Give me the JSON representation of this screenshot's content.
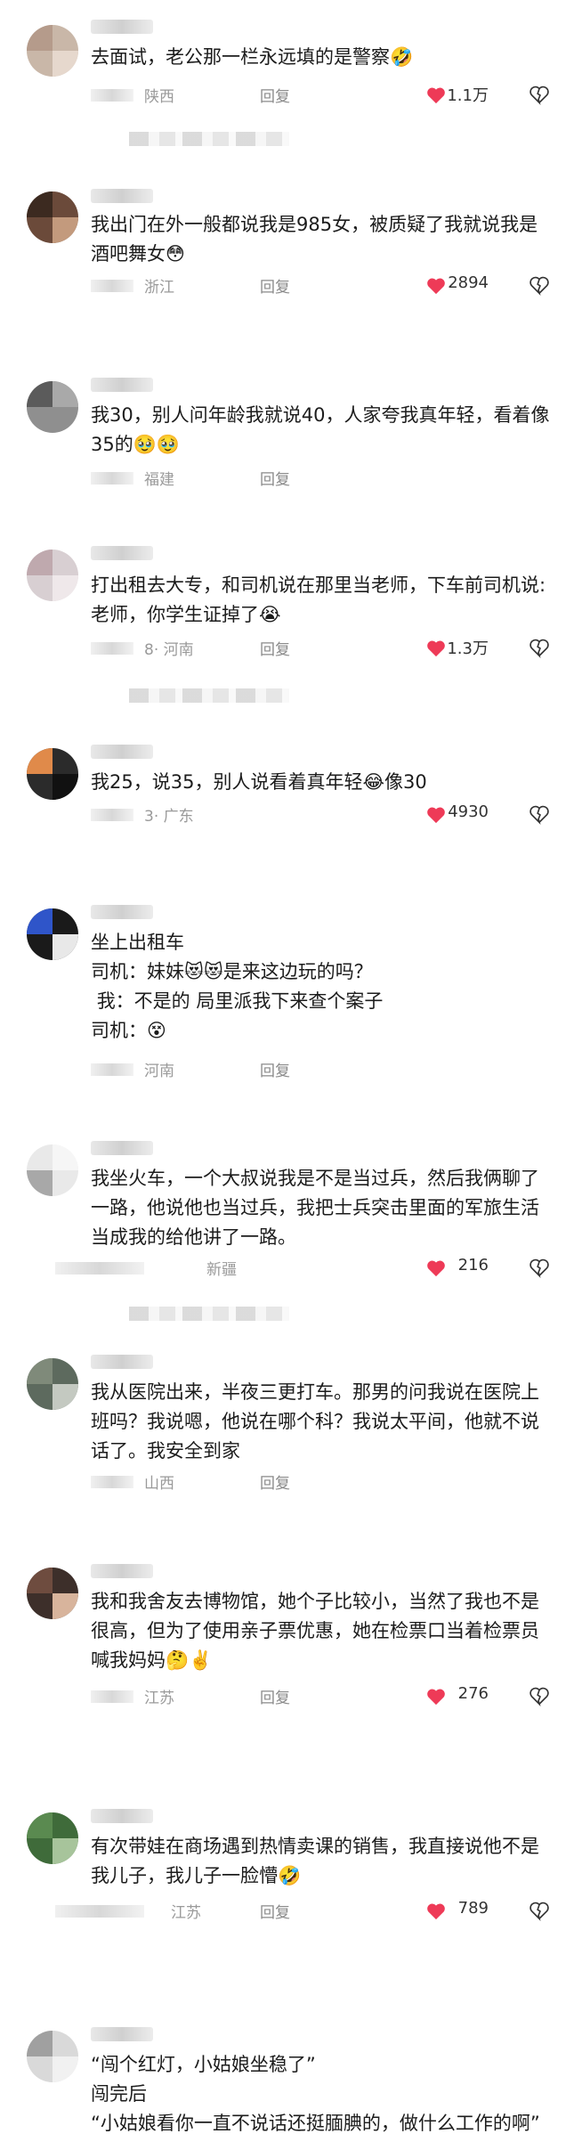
{
  "comments": [
    {
      "body": "去面试，老公那一栏永远填的是警察🤣",
      "location": "陕西",
      "reply": "回复",
      "likes": "1.1万"
    },
    {
      "body": "我出门在外一般都说我是985女，被质疑了我就说我是酒吧舞女😳",
      "location": "浙江",
      "reply": "回复",
      "likes": "2894"
    },
    {
      "body": "我30，别人问年龄我就说40，人家夸我真年轻，看着像35的🥹🥹",
      "location": "福建",
      "reply": "回复",
      "likes": ""
    },
    {
      "body": "打出租去大专，和司机说在那里当老师，下车前司机说:老师，你学生证掉了😭",
      "location": "8· 河南",
      "reply": "回复",
      "likes": "1.3万"
    },
    {
      "body": "我25，说35，别人说看着真年轻😂像30",
      "location": "3· 广东",
      "reply": "回复",
      "likes": "4930"
    },
    {
      "body": "坐上出租车\n司机：妹妹😻😻是来这边玩的吗？\n 我：不是的 局里派我下来查个案子\n司机：😵",
      "location": "河南",
      "reply": "回复",
      "likes": ""
    },
    {
      "body": "我坐火车，一个大叔说我是不是当过兵，然后我俩聊了一路，他说他也当过兵，我把士兵突击里面的军旅生活当成我的给他讲了一路。",
      "location": "新疆",
      "reply": "回复",
      "likes": "216"
    },
    {
      "body": "我从医院出来，半夜三更打车。那男的问我说在医院上班吗？我说嗯，他说在哪个科？我说太平间，他就不说话了。我安全到家",
      "location": "山西",
      "reply": "回复",
      "likes": ""
    },
    {
      "body": "我和我舍友去博物馆，她个子比较小，当然了我也不是很高，但为了使用亲子票优惠，她在检票口当着检票员喊我妈妈🤔✌️",
      "location": "江苏",
      "reply": "回复",
      "likes": "276"
    },
    {
      "body": "有次带娃在商场遇到热情卖课的销售，我直接说他不是我儿子，我儿子一脸懵🤣",
      "location": "江苏",
      "reply": "回复",
      "likes": "789"
    },
    {
      "body": "“闯个红灯，小姑娘坐稳了”\n闯完后\n“小姑娘看你一直不说话还挺腼腆的，做什么工作的啊”",
      "location": "",
      "reply": "",
      "likes": ""
    }
  ],
  "icons": {
    "like": "heart-icon",
    "dislike": "broken-heart-icon"
  },
  "colors": {
    "like": "#ee3a57",
    "meta": "#9a9a9a",
    "text": "#1c1c1c"
  }
}
